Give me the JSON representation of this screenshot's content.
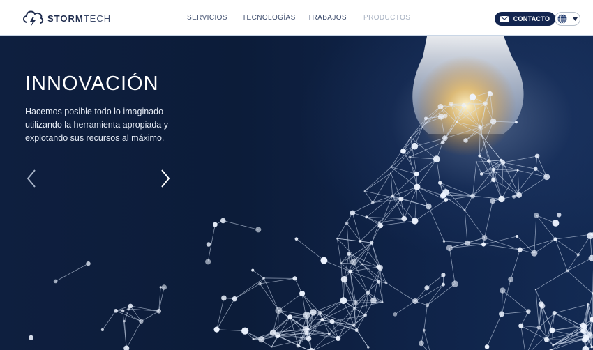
{
  "brand": {
    "name_bold": "STORM",
    "name_light": "TECH"
  },
  "nav": [
    {
      "label": "SERVICIOS"
    },
    {
      "label": "TECNOLOGÍAS"
    },
    {
      "label": "TRABAJOS"
    },
    {
      "label": "PRODUCTOS"
    }
  ],
  "contact": {
    "label": "CONTACTO"
  },
  "language_selector": {
    "icon": "globe-icon"
  },
  "hero": {
    "title": "INNOVACIÓN",
    "text": "Hacemos posible todo lo imaginado utilizando la herramienta apropiada y explotando sus recursos al máximo."
  },
  "colors": {
    "navbar_bg": "#ffffff",
    "brand_navy": "#13254f",
    "hero_bg": "#0e1f3f",
    "nav_text": "#3e4d6d",
    "nav_text_dim": "#a8b2c2"
  }
}
